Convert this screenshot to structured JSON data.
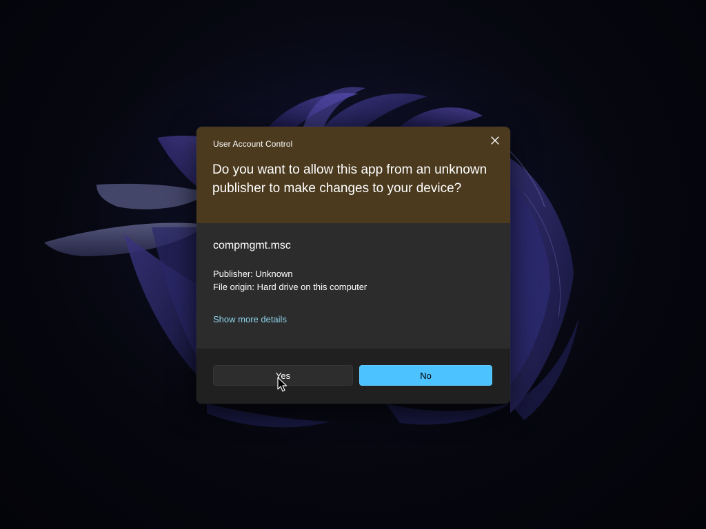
{
  "dialog": {
    "caption": "User Account Control",
    "question": "Do you want to allow this app from an unknown publisher to make changes to your device?",
    "app_name": "compmgmt.msc",
    "publisher": "Publisher: Unknown",
    "file_origin": "File origin: Hard drive on this computer",
    "details_link": "Show more details",
    "yes_label": "Yes",
    "no_label": "No",
    "close_icon": "close-icon"
  },
  "colors": {
    "header_bg": "#4b3a1e",
    "body_bg": "#2c2c2c",
    "footer_bg": "#202020",
    "accent": "#4cc2ff",
    "link": "#8ed4ec"
  }
}
